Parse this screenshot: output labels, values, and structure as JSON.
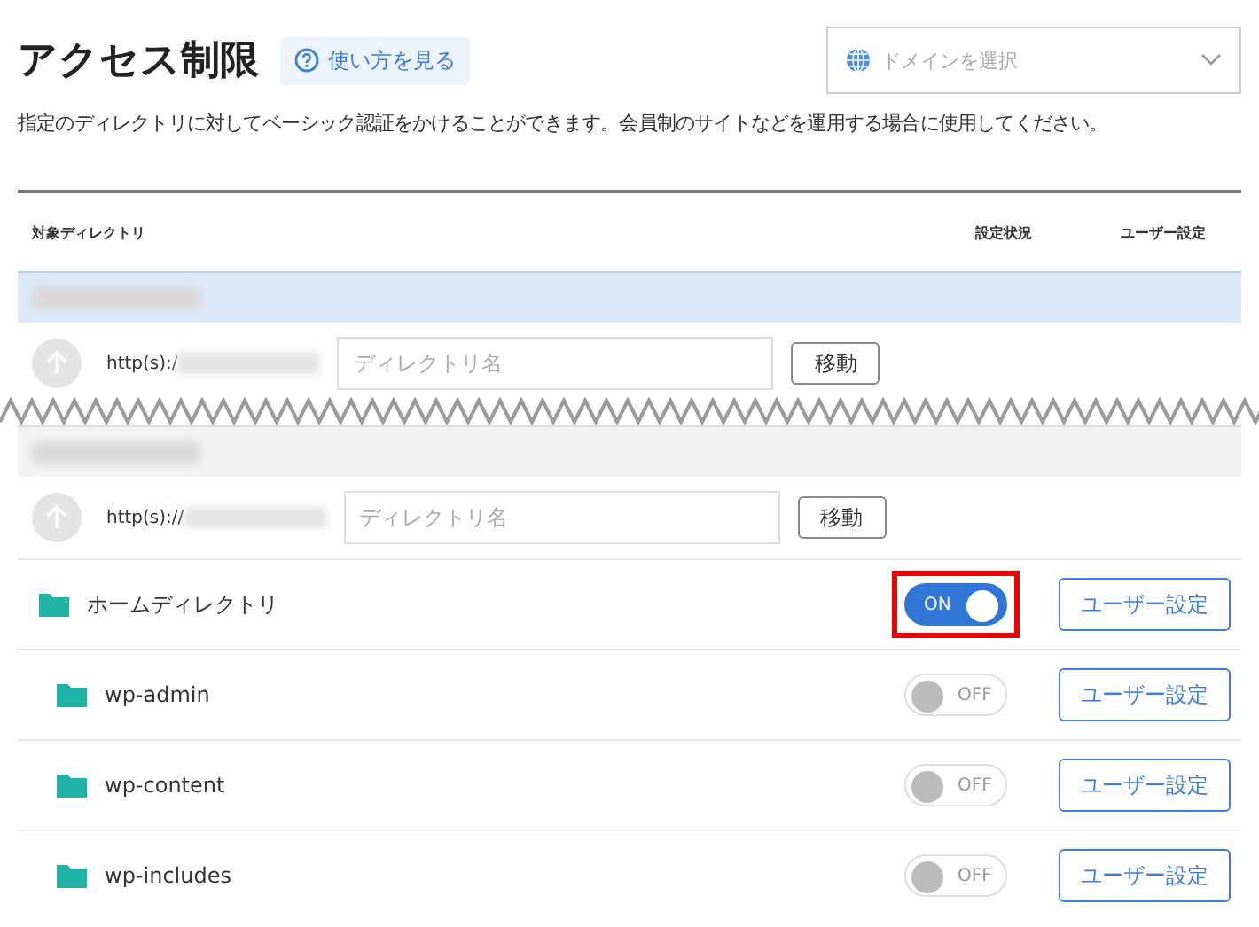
{
  "header": {
    "title": "アクセス制限",
    "help_button": "使い方を見る",
    "domain_select": {
      "placeholder": "ドメインを選択"
    }
  },
  "description": "指定のディレクトリに対してベーシック認証をかけることができます。会員制のサイトなどを運用する場合に使用してください。",
  "table": {
    "columns": [
      "対象ディレクトリ",
      "設定状況",
      "ユーザー設定"
    ],
    "domains": [
      {
        "selected": true,
        "path_prefix": "http(s):/",
        "directory_field": {
          "placeholder": "ディレクトリ名"
        },
        "move_button": "移動"
      },
      {
        "selected": false,
        "path_prefix": "http(s)://",
        "directory_field": {
          "placeholder": "ディレクトリ名"
        },
        "move_button": "移動"
      }
    ],
    "directories": [
      {
        "name": "ホームディレクトリ",
        "on": true,
        "toggle_label": "ON",
        "highlighted": true,
        "button": "ユーザー設定",
        "children": [
          {
            "name": "wp-admin",
            "on": false,
            "toggle_label": "OFF",
            "highlighted": false,
            "button": "ユーザー設定"
          },
          {
            "name": "wp-content",
            "on": false,
            "toggle_label": "OFF",
            "highlighted": false,
            "button": "ユーザー設定"
          },
          {
            "name": "wp-includes",
            "on": false,
            "toggle_label": "OFF",
            "highlighted": false,
            "button": "ユーザー設定"
          }
        ]
      }
    ]
  }
}
